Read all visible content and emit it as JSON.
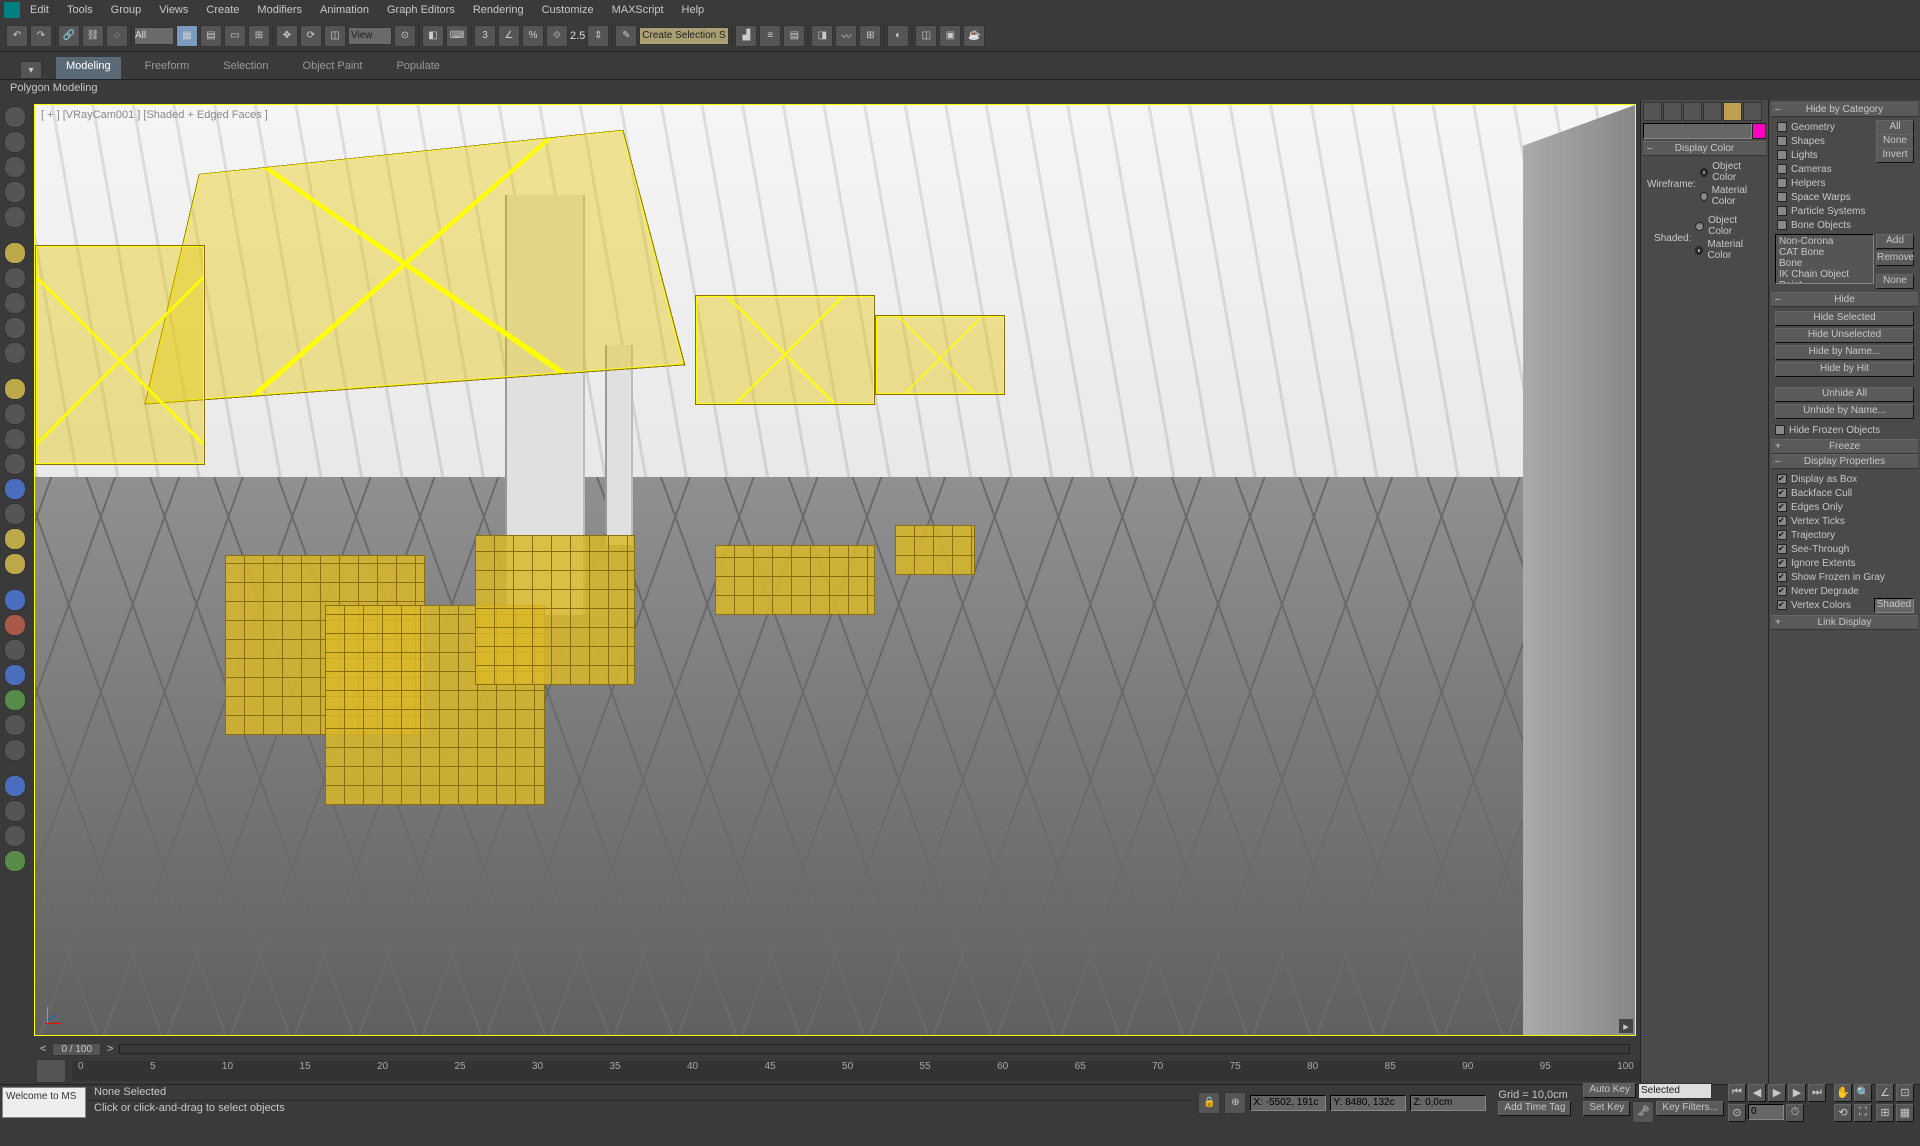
{
  "menu": [
    "Edit",
    "Tools",
    "Group",
    "Views",
    "Create",
    "Modifiers",
    "Animation",
    "Graph Editors",
    "Rendering",
    "Customize",
    "MAXScript",
    "Help"
  ],
  "toolbar": {
    "selFilterValue": "All",
    "viewSelValue": "View",
    "snapValue": "2.5",
    "namedSelPh": "Create Selection Se"
  },
  "ribbonTabs": [
    "Modeling",
    "Freeform",
    "Selection",
    "Object Paint",
    "Populate"
  ],
  "subRibbon": "Polygon Modeling",
  "viewport": {
    "label": "[ + ] [VRayCam001 ] [Shaded + Edged Faces ]"
  },
  "trackbar": {
    "frameLabel": "0 / 100"
  },
  "timelineTicks": [
    "0",
    "5",
    "10",
    "15",
    "20",
    "25",
    "30",
    "35",
    "40",
    "45",
    "50",
    "55",
    "60",
    "65",
    "70",
    "75",
    "80",
    "85",
    "90",
    "95",
    "100"
  ],
  "commandPanel": {
    "displayColor": {
      "title": "Display Color",
      "wireframeLabel": "Wireframe:",
      "shadedLabel": "Shaded:",
      "optObject": "Object Color",
      "optMaterial": "Material Color"
    }
  },
  "displayPanel": {
    "hideCatTitle": "Hide by Category",
    "cats": [
      "Geometry",
      "Shapes",
      "Lights",
      "Cameras",
      "Helpers",
      "Space Warps",
      "Particle Systems",
      "Bone Objects"
    ],
    "catBtns": {
      "all": "All",
      "none": "None",
      "invert": "Invert",
      "add": "Add",
      "remove": "Remove",
      "none2": "None"
    },
    "catList": [
      "Non-Corona",
      "CAT Bone",
      "Bone",
      "IK Chain Object",
      "Point"
    ],
    "hideTitle": "Hide",
    "hideBtns": [
      "Hide Selected",
      "Hide Unselected",
      "Hide by Name...",
      "Hide by Hit",
      "Unhide All",
      "Unhide by Name..."
    ],
    "hideFrozen": "Hide Frozen Objects",
    "freezeTitle": "Freeze",
    "dispPropTitle": "Display Properties",
    "dispProps": [
      "Display as Box",
      "Backface Cull",
      "Edges Only",
      "Vertex Ticks",
      "Trajectory",
      "See-Through",
      "Ignore Extents",
      "Show Frozen in Gray",
      "Never Degrade",
      "Vertex Colors"
    ],
    "shadedBtn": "Shaded",
    "linkTitle": "Link Display"
  },
  "status": {
    "script": "Welcome to MS",
    "sel": "None Selected",
    "prompt": "Click or click-and-drag to select objects",
    "coords": {
      "x": "X: -5502, 191c",
      "y": "Y: 8480, 132c",
      "z": "Z: 0,0cm"
    },
    "grid": "Grid = 10,0cm",
    "addTag": "Add Time Tag",
    "autoKey": "Auto Key",
    "selMode": "Selected",
    "setKey": "Set Key",
    "keyFilters": "Key Filters...",
    "frameField": "0"
  }
}
